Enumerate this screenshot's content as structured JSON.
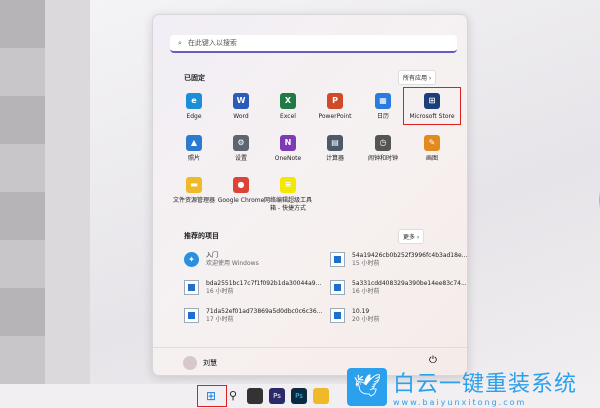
{
  "search": {
    "placeholder": "在此键入以搜索"
  },
  "pinned": {
    "title": "已固定",
    "all_apps": "所有应用",
    "apps": [
      {
        "label": "Edge",
        "color": "#1a8fd8",
        "glyph": "e"
      },
      {
        "label": "Word",
        "color": "#2b5cb8",
        "glyph": "W"
      },
      {
        "label": "Excel",
        "color": "#1f7a45",
        "glyph": "X"
      },
      {
        "label": "PowerPoint",
        "color": "#d04a2a",
        "glyph": "P"
      },
      {
        "label": "日历",
        "color": "#2a7be0",
        "glyph": "▦"
      },
      {
        "label": "Microsoft Store",
        "color": "#1c3f7a",
        "glyph": "⊞"
      },
      {
        "label": "照片",
        "color": "#2a7bd0",
        "glyph": "▲"
      },
      {
        "label": "设置",
        "color": "#5d6670",
        "glyph": "⚙"
      },
      {
        "label": "OneNote",
        "color": "#7b3bb5",
        "glyph": "N"
      },
      {
        "label": "计算器",
        "color": "#4a5a6a",
        "glyph": "▤"
      },
      {
        "label": "闹钟和时钟",
        "color": "#555",
        "glyph": "◷"
      },
      {
        "label": "画图",
        "color": "#e08a20",
        "glyph": "✎"
      },
      {
        "label": "文件资源管理器",
        "color": "#f0b92a",
        "glyph": "▬"
      },
      {
        "label": "Google Chrome",
        "color": "#db4437",
        "glyph": "●"
      },
      {
        "label": "网络编辑超级工具箱 - 快捷方式",
        "color": "#f5e800",
        "glyph": "≡"
      }
    ]
  },
  "recommended": {
    "title": "推荐的项目",
    "more": "更多",
    "items": [
      {
        "name": "入门",
        "sub": "欢迎使用 Windows"
      },
      {
        "name": "54a19426cb0b252f3996fc4b3ad18e...",
        "sub": "15 小时前"
      },
      {
        "name": "bda2551bc17c7f1f092b1da30044a9...",
        "sub": "16 小时前"
      },
      {
        "name": "5a331cdd408329a390be14ee83c74...",
        "sub": "16 小时前"
      },
      {
        "name": "71da52ef01ad73869a5d0dbc0c6c36...",
        "sub": "17 小时前"
      },
      {
        "name": "10.19",
        "sub": "20 小时前"
      }
    ]
  },
  "user": {
    "name": "刘慧"
  },
  "watermark": {
    "title": "白云一键重装系统",
    "url": "www.baiyunxitong.com"
  }
}
